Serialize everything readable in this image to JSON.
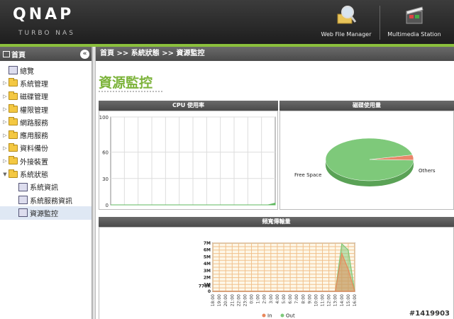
{
  "header": {
    "logo": "QNAP",
    "logo_sub": "TURBO NAS",
    "apps": [
      {
        "label": "Web File Manager",
        "icon": "magnifier-folder-icon"
      },
      {
        "label": "Multimedia Station",
        "icon": "clapperboard-icon"
      }
    ]
  },
  "sidebar": {
    "title": "首頁",
    "collapse": "«",
    "items": [
      {
        "label": "總覽",
        "type": "leaf"
      },
      {
        "label": "系統管理",
        "type": "folder"
      },
      {
        "label": "磁碟管理",
        "type": "folder"
      },
      {
        "label": "權限管理",
        "type": "folder"
      },
      {
        "label": "網路服務",
        "type": "folder"
      },
      {
        "label": "應用服務",
        "type": "folder"
      },
      {
        "label": "資料備份",
        "type": "folder"
      },
      {
        "label": "外接裝置",
        "type": "folder"
      },
      {
        "label": "系統狀態",
        "type": "folder-open"
      },
      {
        "label": "系統資訊",
        "type": "child"
      },
      {
        "label": "系統服務資訊",
        "type": "child"
      },
      {
        "label": "資源監控",
        "type": "child-selected"
      }
    ]
  },
  "main": {
    "breadcrumb": "首頁 >> 系統狀態 >> 資源監控",
    "title": "資源監控",
    "cpu_panel_title": "CPU 使用率",
    "disk_panel_title": "磁碟使用量",
    "bw_panel_title": "頻寬傳輸量"
  },
  "stamp": "#1419903",
  "chart_data": [
    {
      "type": "area",
      "title": "CPU 使用率",
      "yticks": [
        "100",
        "60",
        "30",
        "0"
      ],
      "ytick_values": [
        100,
        60,
        30,
        0
      ],
      "ylim": [
        0,
        100
      ],
      "series": [
        {
          "values": [
            0,
            0,
            0,
            0,
            0,
            0,
            0,
            0,
            0,
            0,
            0,
            0,
            0,
            0,
            0,
            0,
            0,
            0,
            0,
            0,
            0,
            0,
            0,
            2
          ]
        }
      ],
      "color": "#5fb85f",
      "grid": true
    },
    {
      "type": "pie",
      "title": "磁碟使用量",
      "slices": [
        {
          "label": "Free Space",
          "value": 96,
          "color": "#7ec97a"
        },
        {
          "label": "Others",
          "value": 4,
          "color": "#e9876a"
        }
      ]
    },
    {
      "type": "area",
      "title": "頻寬傳輸量",
      "categories": [
        "18:00",
        "19:00",
        "20:00",
        "21:00",
        "22:00",
        "23:00",
        "0:00",
        "1:00",
        "2:00",
        "3:00",
        "4:00",
        "5:00",
        "6:00",
        "7:00",
        "8:00",
        "9:00",
        "10:00",
        "11:00",
        "12:00",
        "13:00",
        "14:00",
        "15:00",
        "16:00"
      ],
      "yticks": [
        "7M",
        "6M",
        "5M",
        "4M",
        "3M",
        "2M",
        "1M",
        "778K",
        "0"
      ],
      "ytick_values": [
        7,
        6,
        5,
        4,
        3,
        2,
        1,
        0.778,
        0
      ],
      "ylim": [
        0,
        7
      ],
      "series": [
        {
          "name": "In",
          "color": "#e9875a",
          "values": [
            0,
            0,
            0,
            0,
            0,
            0,
            0,
            0,
            0,
            0,
            0,
            0,
            0,
            0,
            0,
            0,
            0,
            0,
            0,
            0,
            5.5,
            3.2,
            0
          ]
        },
        {
          "name": "Out",
          "color": "#7ec97a",
          "values": [
            0,
            0,
            0,
            0,
            0,
            0,
            0,
            0,
            0,
            0,
            0,
            0,
            0,
            0,
            0,
            0,
            0,
            0,
            0,
            0,
            6.9,
            6.0,
            0
          ]
        }
      ],
      "legend": "bottom",
      "grid": true
    }
  ]
}
